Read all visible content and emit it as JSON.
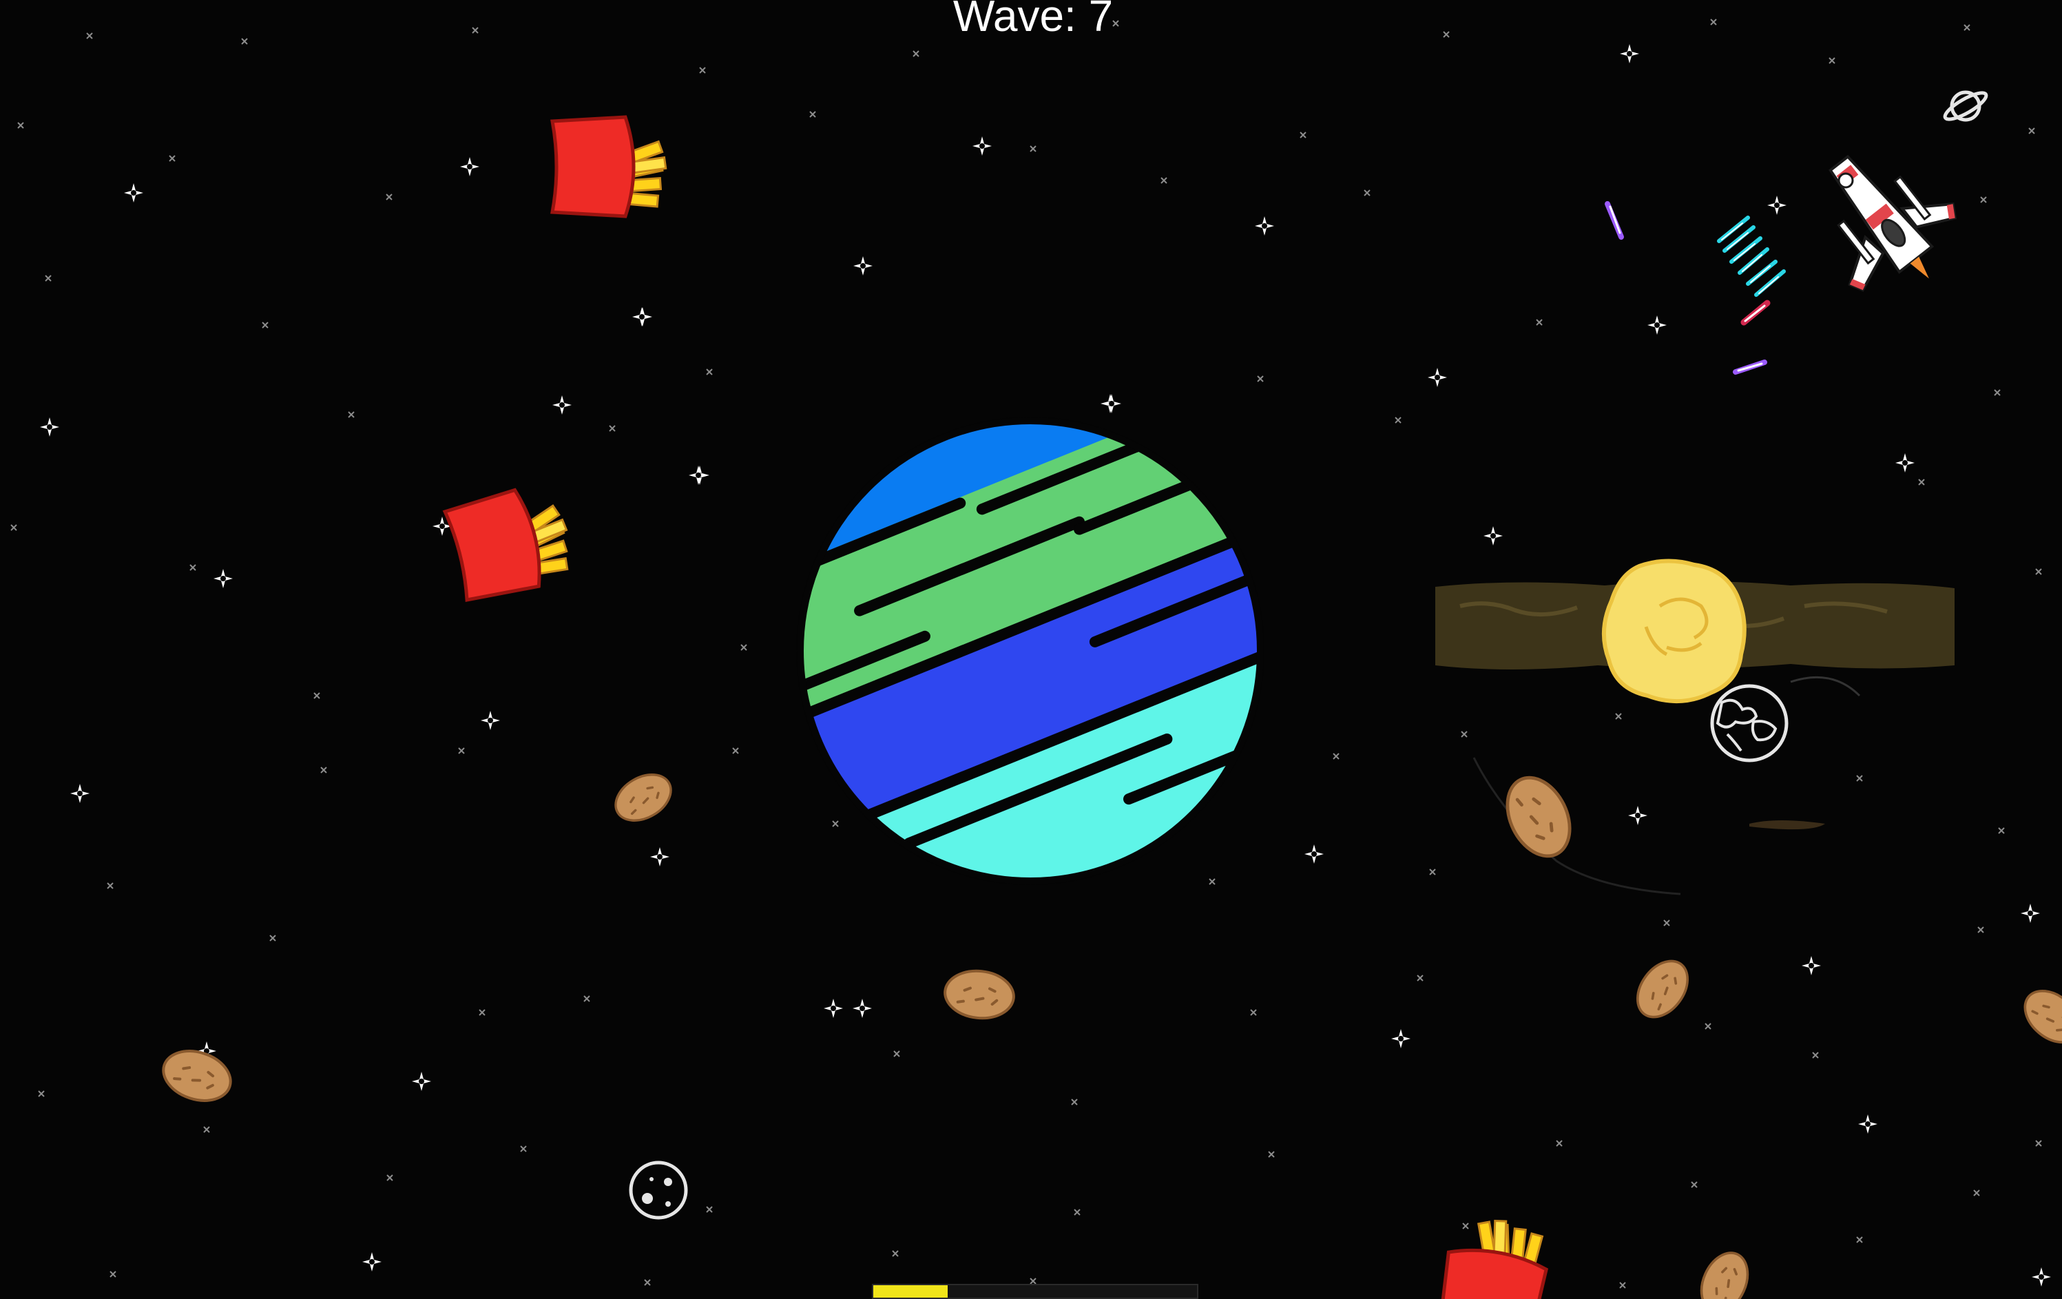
{
  "hud": {
    "wave_prefix": "Wave: ",
    "wave_number": "7"
  },
  "progress_bar": {
    "fill_fraction": 0.23,
    "fill_color": "#f1e51a"
  },
  "colors": {
    "background": "#050505",
    "planet_top": "#0a7cf2",
    "planet_green": "#62d074",
    "planet_blue": "#2f47f0",
    "planet_cyan": "#5ff5e8",
    "fries_box": "#ee2b26",
    "fries": "#ffd21a",
    "potato": "#c8925a",
    "explosion": "#f7de6a",
    "laser_violet": "#9c5bff",
    "laser_cyan": "#2ad6e6"
  },
  "icons": [
    "ringed-planet-icon",
    "moon-icon",
    "earth-globe-icon",
    "spaceship-icon",
    "french-fries-icon",
    "potato-icon",
    "sparkle-star-icon"
  ]
}
